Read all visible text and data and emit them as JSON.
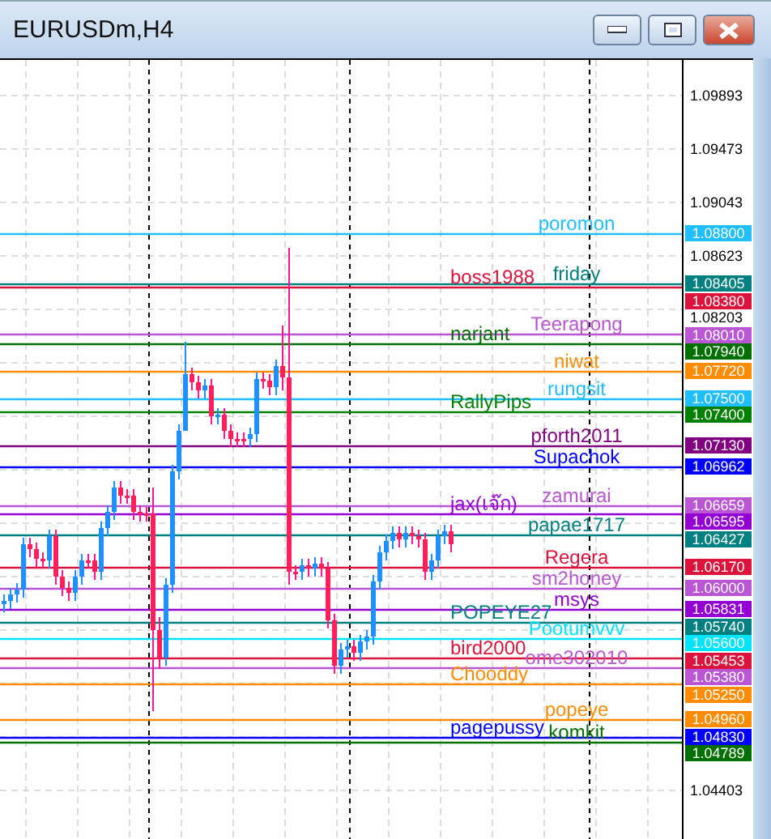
{
  "window": {
    "title": "EURUSDm,H4"
  },
  "axis": {
    "ticks": [
      "1.09893",
      "1.09473",
      "1.09043",
      "1.08623",
      "1.08203",
      "1.04403"
    ]
  },
  "lines": [
    {
      "name": "poromon",
      "price": "1.08800",
      "color": "#1ebeff"
    },
    {
      "name": "friday",
      "price": "1.08405",
      "color": "#008080"
    },
    {
      "name": "boss1988",
      "price": "1.08380",
      "color": "#dc143c"
    },
    {
      "name": "Teerapong",
      "price": "1.08010",
      "color": "#ba55d3"
    },
    {
      "name": "narjant",
      "price": "1.07940",
      "color": "#007000"
    },
    {
      "name": "niwat",
      "price": "1.07720",
      "color": "#ff8c00"
    },
    {
      "name": "rungsit",
      "price": "1.07500",
      "color": "#1ebeff"
    },
    {
      "name": "RallyPips",
      "price": "1.07400",
      "color": "#008000"
    },
    {
      "name": "pforth2011",
      "price": "1.07130",
      "color": "#800080"
    },
    {
      "name": "Supachok",
      "price": "1.06962",
      "color": "#0000ff"
    },
    {
      "name": "zamurai",
      "price": "1.06659",
      "color": "#ba55d3"
    },
    {
      "name": "jax(เจ๊ก)",
      "price": "1.06595",
      "color": "#9400d3"
    },
    {
      "name": "papae1717",
      "price": "1.06427",
      "color": "#008080"
    },
    {
      "name": "Regera",
      "price": "1.06170",
      "color": "#dc143c"
    },
    {
      "name": "sm2honey",
      "price": "1.06000",
      "color": "#ba55d3"
    },
    {
      "name": "msys",
      "price": "1.05831",
      "color": "#9400d3"
    },
    {
      "name": "POPEYE27",
      "price": "1.05740",
      "color": "#008080"
    },
    {
      "name": "Pootumvvv",
      "price": "1.05600",
      "color": "#00e5ff"
    },
    {
      "name": "bird2000",
      "price": "1.05453",
      "color": "#dc143c"
    },
    {
      "name": "ome302010",
      "price": "1.05380",
      "color": "#ba55d3"
    },
    {
      "name": "Chooddy",
      "price": "1.05250",
      "color": "#ff8c00"
    },
    {
      "name": "popeye",
      "price": "1.04960",
      "color": "#ff8c00"
    },
    {
      "name": "pagepussy",
      "price": "1.04830",
      "color": "#0000ff"
    },
    {
      "name": "komkit",
      "price": "1.04789",
      "color": "#007000"
    }
  ]
}
